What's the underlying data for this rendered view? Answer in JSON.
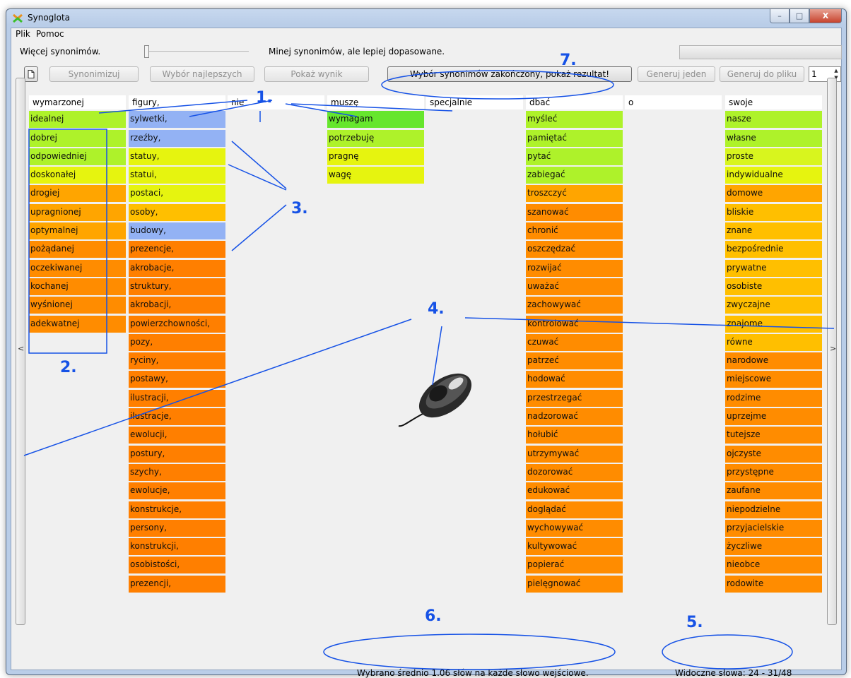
{
  "window": {
    "title": "Synoglota",
    "controls": {
      "minimize": "–",
      "maximize": "□",
      "close": "X"
    }
  },
  "menu": {
    "items": [
      "Plik",
      "Pomoc"
    ]
  },
  "slider": {
    "left_label": "Więcej synonimów.",
    "right_label": "Minej synonimów, ale lepiej dopasowane."
  },
  "toolbar": {
    "new_icon": "document-icon",
    "buttons": [
      {
        "label": "Synonimizuj",
        "enabled": false
      },
      {
        "label": "Wybór najlepszych",
        "enabled": false
      },
      {
        "label": "Pokaż wynik",
        "enabled": false
      },
      {
        "label": "Wybór synonimów zakończony, pokaż rezultat!",
        "enabled": true
      },
      {
        "label": "Generuj jeden",
        "enabled": false
      },
      {
        "label": "Generuj do pliku",
        "enabled": false
      }
    ],
    "spin_value": "1"
  },
  "scroll": {
    "left": "<",
    "right": ">"
  },
  "colors": {
    "green": "#66e62d",
    "light_green": "#aef22a",
    "yellow_green": "#d8f51e",
    "yellow": "#e6f40f",
    "orange_1": "#ffbf00",
    "orange_2": "#ffa500",
    "orange_3": "#ff8c00",
    "orange_4": "#ff7f00",
    "selected_blue": "#93b2f4",
    "annotation_blue": "#1652e6"
  },
  "columns": [
    {
      "header": "wymarzonej",
      "cells": [
        {
          "text": "idealnej",
          "color": "c-lg"
        },
        {
          "text": "dobrej",
          "color": "c-lg"
        },
        {
          "text": "odpowiedniej",
          "color": "c-lg"
        },
        {
          "text": "doskonałej",
          "color": "c-y"
        },
        {
          "text": "drogiej",
          "color": "c-o2"
        },
        {
          "text": "upragnionej",
          "color": "c-o2"
        },
        {
          "text": "optymalnej",
          "color": "c-o2"
        },
        {
          "text": "pożądanej",
          "color": "c-o3"
        },
        {
          "text": "oczekiwanej",
          "color": "c-o3"
        },
        {
          "text": "kochanej",
          "color": "c-o3"
        },
        {
          "text": "wyśnionej",
          "color": "c-o3"
        },
        {
          "text": "adekwatnej",
          "color": "c-o3"
        }
      ]
    },
    {
      "header": "figury,",
      "cells": [
        {
          "text": "sylwetki,",
          "color": "c-b"
        },
        {
          "text": "rzeźby,",
          "color": "c-b"
        },
        {
          "text": "statuy,",
          "color": "c-y"
        },
        {
          "text": "statui,",
          "color": "c-y"
        },
        {
          "text": "postaci,",
          "color": "c-y"
        },
        {
          "text": "osoby,",
          "color": "c-o1"
        },
        {
          "text": "budowy,",
          "color": "c-b"
        },
        {
          "text": "prezencje,",
          "color": "c-o4"
        },
        {
          "text": "akrobacje,",
          "color": "c-o4"
        },
        {
          "text": "struktury,",
          "color": "c-o4"
        },
        {
          "text": "akrobacji,",
          "color": "c-o4"
        },
        {
          "text": "powierzchowności,",
          "color": "c-o4"
        },
        {
          "text": "pozy,",
          "color": "c-o4"
        },
        {
          "text": "ryciny,",
          "color": "c-o4"
        },
        {
          "text": "postawy,",
          "color": "c-o4"
        },
        {
          "text": "ilustracji,",
          "color": "c-o4"
        },
        {
          "text": "ilustracje,",
          "color": "c-o4"
        },
        {
          "text": "ewolucji,",
          "color": "c-o4"
        },
        {
          "text": "postury,",
          "color": "c-o4"
        },
        {
          "text": "szychy,",
          "color": "c-o4"
        },
        {
          "text": "ewolucje,",
          "color": "c-o4"
        },
        {
          "text": "konstrukcje,",
          "color": "c-o4"
        },
        {
          "text": "persony,",
          "color": "c-o4"
        },
        {
          "text": "konstrukcji,",
          "color": "c-o4"
        },
        {
          "text": "osobistości,",
          "color": "c-o4"
        },
        {
          "text": "prezencji,",
          "color": "c-o4"
        }
      ]
    },
    {
      "header": "nie",
      "cells": []
    },
    {
      "header": "muszę",
      "cells": [
        {
          "text": "wymagam",
          "color": "c-g"
        },
        {
          "text": "potrzebuję",
          "color": "c-lg"
        },
        {
          "text": "pragnę",
          "color": "c-y"
        },
        {
          "text": "wagę",
          "color": "c-y"
        }
      ]
    },
    {
      "header": "specjalnie",
      "cells": []
    },
    {
      "header": "dbać",
      "cells": [
        {
          "text": "myśleć",
          "color": "c-lg"
        },
        {
          "text": "pamiętać",
          "color": "c-lg"
        },
        {
          "text": "pytać",
          "color": "c-lg"
        },
        {
          "text": "zabiegać",
          "color": "c-lg"
        },
        {
          "text": "troszczyć",
          "color": "c-o2"
        },
        {
          "text": "szanować",
          "color": "c-o3"
        },
        {
          "text": "chronić",
          "color": "c-o3"
        },
        {
          "text": "oszczędzać",
          "color": "c-o3"
        },
        {
          "text": "rozwijać",
          "color": "c-o3"
        },
        {
          "text": "uważać",
          "color": "c-o3"
        },
        {
          "text": "zachowywać",
          "color": "c-o3"
        },
        {
          "text": "kontrolować",
          "color": "c-o3"
        },
        {
          "text": "czuwać",
          "color": "c-o3"
        },
        {
          "text": "patrzeć",
          "color": "c-o3"
        },
        {
          "text": "hodować",
          "color": "c-o3"
        },
        {
          "text": "przestrzegać",
          "color": "c-o3"
        },
        {
          "text": "nadzorować",
          "color": "c-o3"
        },
        {
          "text": "hołubić",
          "color": "c-o3"
        },
        {
          "text": "utrzymywać",
          "color": "c-o3"
        },
        {
          "text": "dozorować",
          "color": "c-o3"
        },
        {
          "text": "edukować",
          "color": "c-o3"
        },
        {
          "text": "doglądać",
          "color": "c-o3"
        },
        {
          "text": "wychowywać",
          "color": "c-o3"
        },
        {
          "text": "kultywować",
          "color": "c-o3"
        },
        {
          "text": "popierać",
          "color": "c-o3"
        },
        {
          "text": "pielęgnować",
          "color": "c-o3"
        }
      ]
    },
    {
      "header": "o",
      "cells": []
    },
    {
      "header": "swoje",
      "cells": [
        {
          "text": "nasze",
          "color": "c-lg"
        },
        {
          "text": "własne",
          "color": "c-lg"
        },
        {
          "text": "proste",
          "color": "c-yg"
        },
        {
          "text": "indywidualne",
          "color": "c-y"
        },
        {
          "text": "domowe",
          "color": "c-o2"
        },
        {
          "text": "bliskie",
          "color": "c-o1"
        },
        {
          "text": "znane",
          "color": "c-o1"
        },
        {
          "text": "bezpośrednie",
          "color": "c-o1"
        },
        {
          "text": "prywatne",
          "color": "c-o1"
        },
        {
          "text": "osobiste",
          "color": "c-o1"
        },
        {
          "text": "zwyczajne",
          "color": "c-o1"
        },
        {
          "text": "znajome",
          "color": "c-o1"
        },
        {
          "text": "równe",
          "color": "c-o1"
        },
        {
          "text": "narodowe",
          "color": "c-o3"
        },
        {
          "text": "miejscowe",
          "color": "c-o3"
        },
        {
          "text": "rodzime",
          "color": "c-o3"
        },
        {
          "text": "uprzejme",
          "color": "c-o3"
        },
        {
          "text": "tutejsze",
          "color": "c-o3"
        },
        {
          "text": "ojczyste",
          "color": "c-o3"
        },
        {
          "text": "przystępne",
          "color": "c-o3"
        },
        {
          "text": "zaufane",
          "color": "c-o3"
        },
        {
          "text": "niepodzielne",
          "color": "c-o3"
        },
        {
          "text": "przyjacielskie",
          "color": "c-o3"
        },
        {
          "text": "życzliwe",
          "color": "c-o3"
        },
        {
          "text": "nieobce",
          "color": "c-o3"
        },
        {
          "text": "rodowite",
          "color": "c-o3"
        }
      ]
    }
  ],
  "status": {
    "selected_avg": "Wybrano średnio 1.06 słów na każde słowo wejściowe.",
    "visible_words": "Widoczne słowa: 24 - 31/48"
  },
  "annotations": [
    "1.",
    "2.",
    "3.",
    "4.",
    "5.",
    "6.",
    "7."
  ]
}
